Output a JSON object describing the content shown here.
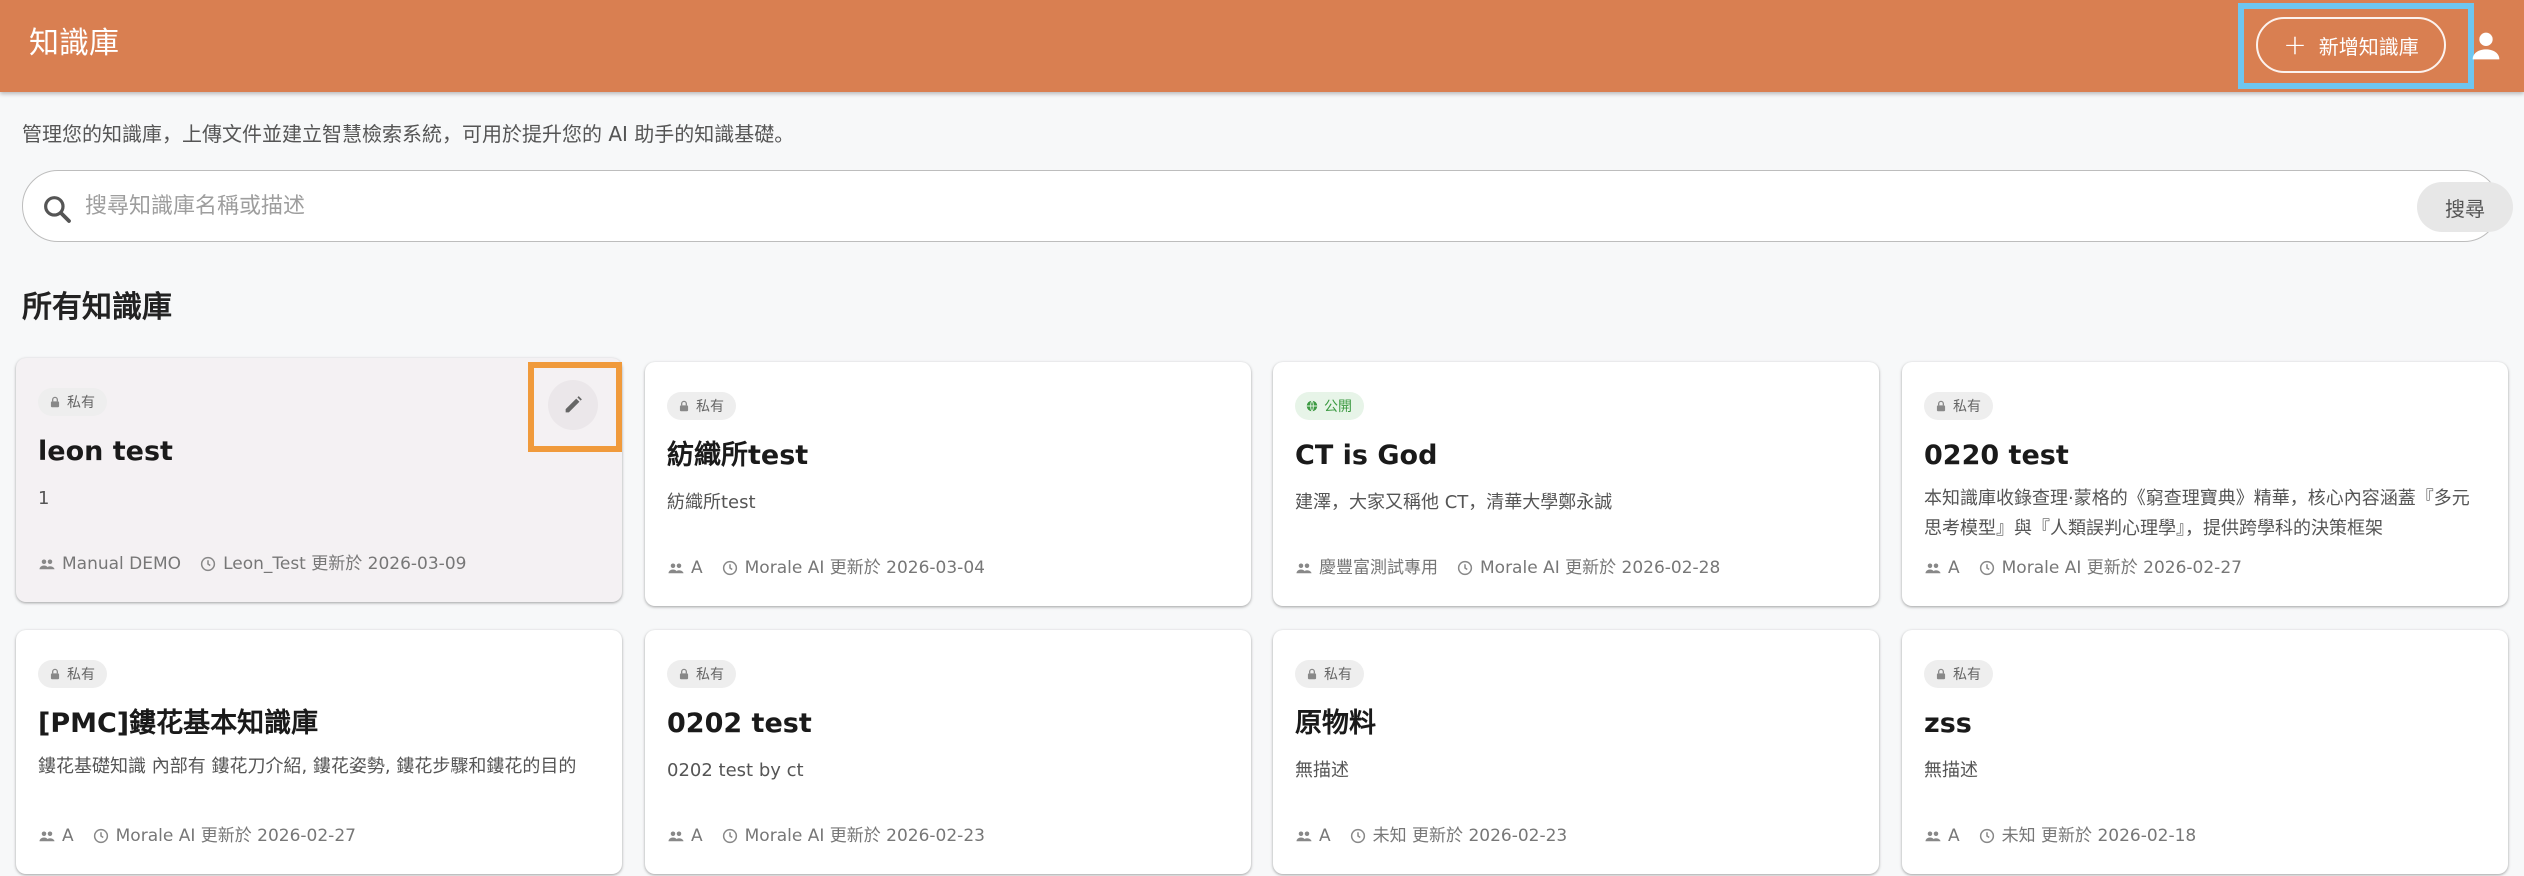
{
  "header": {
    "title": "知識庫",
    "add_button_label": "新增知識庫",
    "add_button_icon": "plus-icon",
    "user_icon": "person-icon",
    "bar_color": "#d97f51"
  },
  "page": {
    "description": "管理您的知識庫，上傳文件並建立智慧檢索系統，可用於提升您的 AI 助手的知識基礎。",
    "section_title": "所有知識庫"
  },
  "search": {
    "placeholder": "搜尋知識庫名稱或描述",
    "value": "",
    "button_label": "搜尋"
  },
  "cards": [
    {
      "visibility": "私有",
      "public": false,
      "title": "leon test",
      "description": "1",
      "group": "Manual DEMO",
      "updated": "Leon_Test 更新於 2026-03-09"
    },
    {
      "visibility": "私有",
      "public": false,
      "title": "紡織所test",
      "description": "紡織所test",
      "group": "A",
      "updated": "Morale AI 更新於 2026-03-04"
    },
    {
      "visibility": "公開",
      "public": true,
      "title": "CT is God",
      "description": "建澤，大家又稱他 CT，清華大學鄭永誠",
      "group": "慶豐富測試專用",
      "updated": "Morale AI 更新於 2026-02-28"
    },
    {
      "visibility": "私有",
      "public": false,
      "title": "0220 test",
      "description": "本知識庫收錄查理·蒙格的《窮查理寶典》精華，核心內容涵蓋『多元思考模型』與『人類誤判心理學』，提供跨學科的決策框架",
      "group": "A",
      "updated": "Morale AI 更新於 2026-02-27"
    },
    {
      "visibility": "私有",
      "public": false,
      "title": "[PMC]鏤花基本知識庫",
      "description": "鏤花基礎知識 內部有 鏤花刀介紹, 鏤花姿勢, 鏤花步驟和鏤花的目的",
      "group": "A",
      "updated": "Morale AI 更新於 2026-02-27"
    },
    {
      "visibility": "私有",
      "public": false,
      "title": "0202 test",
      "description": "0202 test by ct",
      "group": "A",
      "updated": "Morale AI 更新於 2026-02-23"
    },
    {
      "visibility": "私有",
      "public": false,
      "title": "原物料",
      "description": "無描述",
      "group": "A",
      "updated": "未知 更新於 2026-02-23"
    },
    {
      "visibility": "私有",
      "public": false,
      "title": "zss",
      "description": "無描述",
      "group": "A",
      "updated": "未知 更新於 2026-02-18"
    }
  ]
}
